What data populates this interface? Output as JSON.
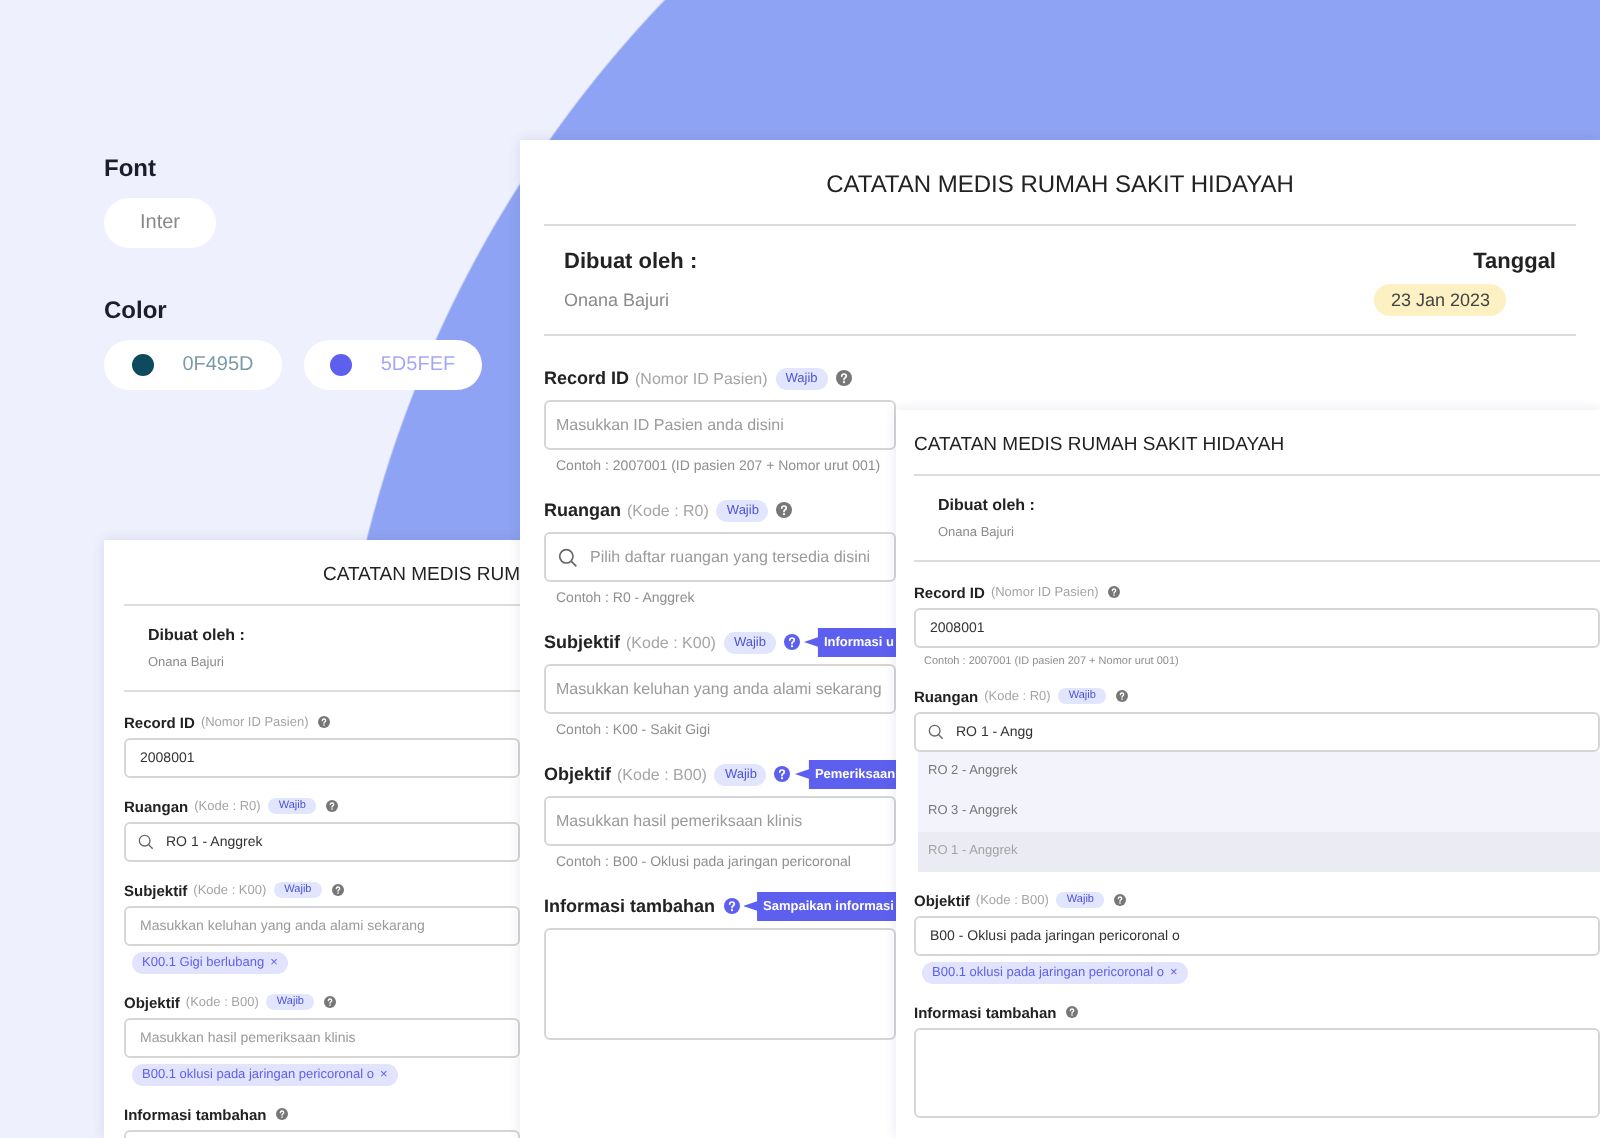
{
  "style_panel": {
    "font": {
      "heading": "Font",
      "value": "Inter"
    },
    "color": {
      "heading": "Color",
      "swatches": [
        {
          "label": "0F495D",
          "color": "#0f495d"
        },
        {
          "label": "5D5FEF",
          "color": "#5d5fef"
        }
      ]
    }
  },
  "cards": [
    {
      "title": "CATATAN MEDIS RUM",
      "author_label": "Dibuat oleh :",
      "author": "Onana Bajuri",
      "fields": [
        {
          "kind": "text",
          "label": "Record ID",
          "hint": "(Nomor ID Pasien)",
          "value": "2008001"
        },
        {
          "kind": "search",
          "label": "Ruangan",
          "hint": "(Kode : R0)",
          "badge": "Wajib",
          "value": "RO 1 - Anggrek"
        },
        {
          "kind": "text",
          "label": "Subjektif",
          "hint": "(Kode : K00)",
          "badge": "Wajib",
          "placeholder": "Masukkan keluhan yang anda alami sekarang",
          "chips": [
            {
              "label": "K00.1 Gigi berlubang",
              "remove": "×"
            }
          ]
        },
        {
          "kind": "text",
          "label": "Objektif",
          "hint": "(Kode : B00)",
          "badge": "Wajib",
          "placeholder": "Masukkan hasil pemeriksaan klinis",
          "chips": [
            {
              "label": "B00.1 oklusi pada jaringan pericoronal o",
              "remove": "×"
            }
          ]
        },
        {
          "kind": "textarea",
          "label": "Informasi tambahan"
        }
      ]
    },
    {
      "title": "CATATAN MEDIS RUMAH SAKIT HIDAYAH",
      "author_label": "Dibuat oleh :",
      "author": "Onana Bajuri",
      "date_label": "Tanggal",
      "date": "23 Jan 2023",
      "fields": [
        {
          "kind": "text",
          "label": "Record ID",
          "hint": "(Nomor ID Pasien)",
          "badge": "Wajib",
          "placeholder": "Masukkan ID Pasien anda disini",
          "example": "Contoh : 2007001 (ID pasien 207 + Nomor urut 001)"
        },
        {
          "kind": "search",
          "label": "Ruangan",
          "hint": "(Kode : R0)",
          "badge": "Wajib",
          "placeholder": "Pilih daftar ruangan yang tersedia disini",
          "example": "Contoh : R0 - Anggrek"
        },
        {
          "kind": "text",
          "label": "Subjektif",
          "hint": "(Kode : K00)",
          "badge": "Wajib",
          "tooltip": "Informasi u",
          "placeholder": "Masukkan keluhan yang anda alami sekarang",
          "example": "Contoh : K00 - Sakit Gigi"
        },
        {
          "kind": "text",
          "label": "Objektif",
          "hint": "(Kode : B00)",
          "badge": "Wajib",
          "tooltip": "Pemeriksaan",
          "placeholder": "Masukkan hasil pemeriksaan klinis",
          "example": "Contoh : B00 - Oklusi pada jaringan pericoronal"
        },
        {
          "kind": "textarea",
          "label": "Informasi tambahan",
          "tooltip": "Sampaikan informasi"
        }
      ]
    },
    {
      "title": "CATATAN MEDIS RUMAH SAKIT HIDAYAH",
      "author_label": "Dibuat oleh :",
      "author": "Onana Bajuri",
      "fields": [
        {
          "kind": "text",
          "label": "Record ID",
          "hint": "(Nomor ID Pasien)",
          "value": "2008001",
          "example": "Contoh : 2007001 (ID pasien 207 + Nomor urut 001)"
        },
        {
          "kind": "search",
          "label": "Ruangan",
          "hint": "(Kode : R0)",
          "badge": "Wajib",
          "value": "RO 1 - Angg",
          "options": [
            {
              "label": "RO 2 - Anggrek",
              "selected": false
            },
            {
              "label": "RO 3 - Anggrek",
              "selected": false
            },
            {
              "label": "RO 1 - Anggrek",
              "selected": true
            }
          ]
        },
        {
          "kind": "text",
          "label": "Objektif",
          "hint": "(Kode : B00)",
          "badge": "Wajib",
          "value": "B00 - Oklusi pada jaringan pericoronal o",
          "chips": [
            {
              "label": "B00.1 oklusi pada jaringan pericoronal o",
              "remove": "×"
            }
          ]
        },
        {
          "kind": "textarea",
          "label": "Informasi tambahan"
        }
      ]
    }
  ]
}
